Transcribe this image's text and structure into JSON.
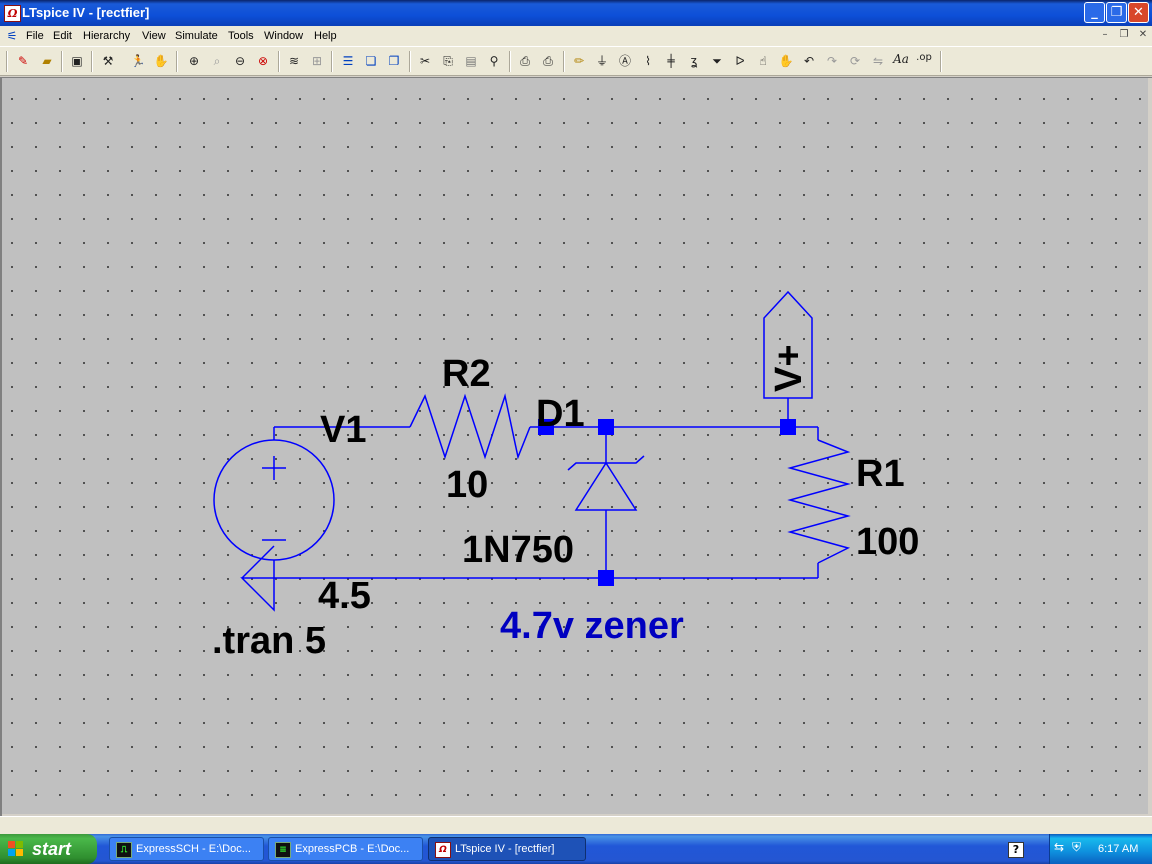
{
  "window": {
    "title": "LTspice IV - [rectfier]",
    "app_icon": "ltspice-logo-icon",
    "controls": [
      "minimize-icon",
      "restore-icon",
      "close-icon"
    ]
  },
  "menu": {
    "items": [
      "File",
      "Edit",
      "Hierarchy",
      "View",
      "Simulate",
      "Tools",
      "Window",
      "Help"
    ],
    "mdi_controls": [
      "minimize-icon",
      "restore-icon",
      "close-icon"
    ]
  },
  "toolbar": {
    "buttons": [
      "new-schematic-icon",
      "open-icon",
      "save-icon",
      "control-panel-icon",
      "run-icon",
      "halt-icon",
      "zoom-in-icon",
      "pan-icon",
      "zoom-out-icon",
      "zoom-fit-icon",
      "autorange-icon",
      "zoom-back-icon",
      "tile-icon",
      "cascade-icon",
      "close-window-icon",
      "cut-icon",
      "copy-icon",
      "paste-icon",
      "find-icon",
      "print-setup-icon",
      "print-icon",
      "draw-wire-icon",
      "ground-icon",
      "net-label-icon",
      "resistor-icon",
      "capacitor-icon",
      "inductor-icon",
      "diode-icon",
      "component-icon",
      "move-icon",
      "drag-icon",
      "undo-icon",
      "redo-icon",
      "rotate-icon",
      "mirror-icon",
      "text-icon",
      "spice-directive-icon"
    ],
    "text_label": "Aa",
    "op_label": ".op"
  },
  "schematic": {
    "source": {
      "name": "V1",
      "value": "4.5"
    },
    "resistor_series": {
      "name": "R2",
      "value": "10"
    },
    "zener": {
      "name": "D1",
      "value": "1N750"
    },
    "load": {
      "name": "R1",
      "value": "100"
    },
    "net_label": "V+",
    "comment": "4.7v zener",
    "directive": ".tran 5",
    "colors": {
      "wire": "#0000FF",
      "junction": "#0000FF",
      "comment": "#0000C0",
      "text": "#000000",
      "background": "#C0C0C0"
    }
  },
  "taskbar": {
    "start_label": "start",
    "tasks": [
      {
        "label": "ExpressSCH - E:\\Doc...",
        "icon": "expresssch-icon",
        "active": false
      },
      {
        "label": "ExpressPCB - E:\\Doc...",
        "icon": "expresspcb-icon",
        "active": false
      },
      {
        "label": "LTspice IV - [rectfier]",
        "icon": "ltspice-logo-icon",
        "active": true
      }
    ],
    "clock": "6:17 AM"
  }
}
